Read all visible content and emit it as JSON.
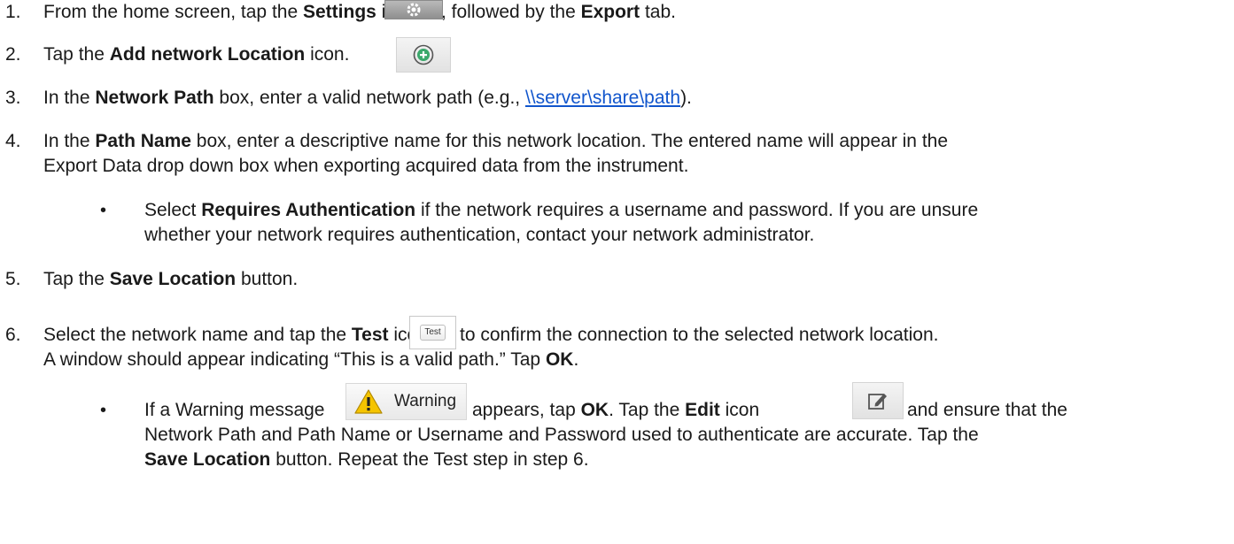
{
  "steps": [
    {
      "number": "1.",
      "t1": "From the home screen, tap the ",
      "b1": "Settings",
      "t2": " icon",
      "t3": ", followed by the ",
      "b2": "Export",
      "t4": " tab."
    },
    {
      "number": "2.",
      "t1": "Tap the ",
      "b1": "Add network Location",
      "t2": " icon."
    },
    {
      "number": "3.",
      "t1": "In the ",
      "b1": "Network Path",
      "t2": " box, enter a valid network path (e.g., ",
      "link": "\\\\server\\share\\path",
      "t3": ")."
    },
    {
      "number": "4.",
      "t1": "In the ",
      "b1": "Path Name",
      "t2": " box, enter a descriptive name for this network location.  The entered name will appear in the",
      "line2": "Export Data drop down box when exporting acquired data from the instrument.",
      "bullet": {
        "t1": "Select ",
        "b1": "Requires Authentication",
        "t2": " if the network requires a username and password.  If you are unsure",
        "line2": "whether your network requires authentication, contact your network administrator."
      }
    },
    {
      "number": "5.",
      "t1": "Tap the ",
      "b1": "Save Location",
      "t2": " button."
    },
    {
      "number": "6.",
      "t1": "Select the network name and tap the ",
      "b1": "Test",
      "t2": " icon",
      "t3": "to confirm the connection to the selected network location.",
      "line2a": "A window should appear indicating “This is a valid path.” Tap ",
      "line2b": "OK",
      "line2c": ".",
      "bullet": {
        "t1": "If a Warning message",
        "t2": "appears, tap ",
        "b1": "OK",
        "t3": ".  Tap the ",
        "b2": "Edit",
        "t4": " icon",
        "t5": "and ensure that the",
        "line2": "Network Path and Path Name or Username and Password used to authenticate are accurate.  Tap the",
        "line3b": "Save Location",
        "line3a": " button.  Repeat the Test step in step 6."
      }
    }
  ],
  "icons": {
    "test_label": "Test",
    "warning_label": "Warning"
  },
  "colors": {
    "link": "#1155cc",
    "warning_yellow": "#f5c400",
    "add_icon_green": "#3aa86b"
  }
}
